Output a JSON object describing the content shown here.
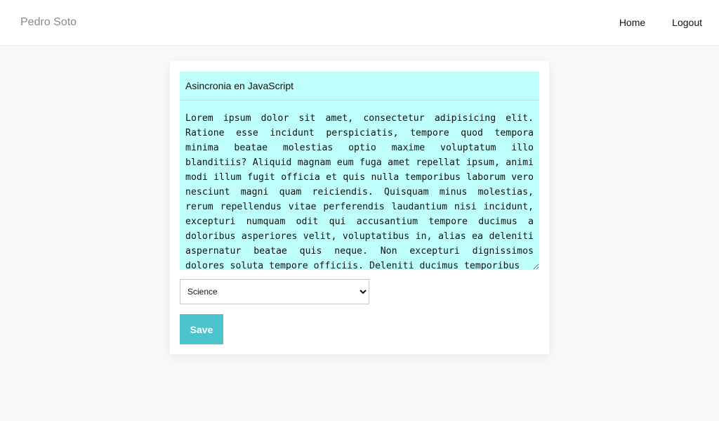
{
  "navbar": {
    "brand": "Pedro Soto",
    "links": [
      {
        "label": "Home"
      },
      {
        "label": "Logout"
      }
    ]
  },
  "form": {
    "title_value": "Asincronia en JavaScript",
    "body_value": "Lorem ipsum dolor sit amet, consectetur adipisicing elit. Ratione esse incidunt perspiciatis, tempore quod tempora minima beatae molestias optio maxime voluptatum illo blanditiis? Aliquid magnam eum fuga amet repellat ipsum, animi modi illum fugit officia et quis nulla temporibus laborum vero nesciunt magni quam reiciendis. Quisquam minus molestias, rerum repellendus vitae perferendis laudantium nisi incidunt, excepturi numquam odit qui accusantium tempore ducimus a doloribus asperiores velit, voluptatibus in, alias ea deleniti aspernatur beatae quis neque. Non excepturi dignissimos dolores soluta tempore officiis. Deleniti ducimus temporibus",
    "category_selected": "Science",
    "save_label": "Save"
  },
  "colors": {
    "input_background": "#bffffb",
    "save_button": "#4ac3cc",
    "page_background": "#f7f9f8"
  }
}
